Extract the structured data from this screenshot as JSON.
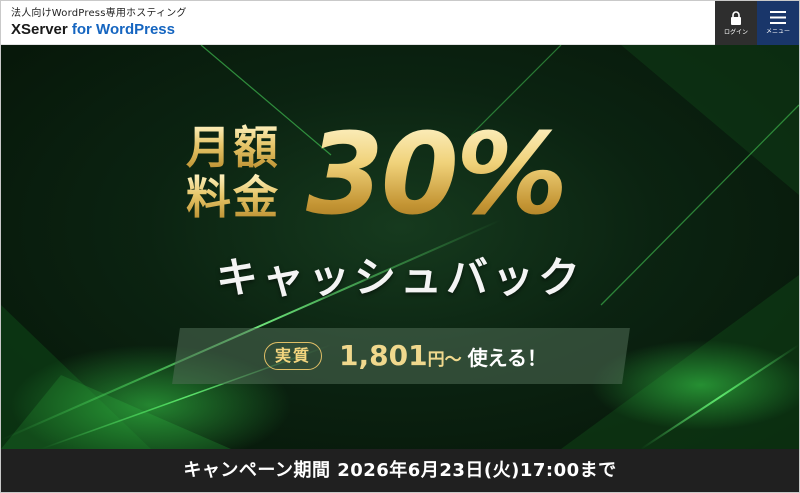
{
  "header": {
    "logo_subtitle": "法人向けWordPress専用ホスティング",
    "logo_brand": "XServer",
    "logo_product": "for WordPress",
    "login_label": "ログイン",
    "menu_label": "メニュー"
  },
  "hero": {
    "headline_line1": "月額",
    "headline_line2": "料金",
    "percent": "30%",
    "subheadline": "キャッシュバック",
    "tag": "実質",
    "price_value": "1,801",
    "price_unit": "円〜",
    "price_suffix": "使える！"
  },
  "campaign": {
    "period_text": "キャンペーン期間 2026年6月23日(火)17:00まで"
  },
  "colors": {
    "gold": "#e6c568",
    "hero_green": "#0b2311",
    "menu_blue": "#19366a",
    "login_dark": "#2e2e2e",
    "bar_dark": "#202020"
  },
  "icons": {
    "login": "lock-icon",
    "menu": "hamburger-icon"
  }
}
